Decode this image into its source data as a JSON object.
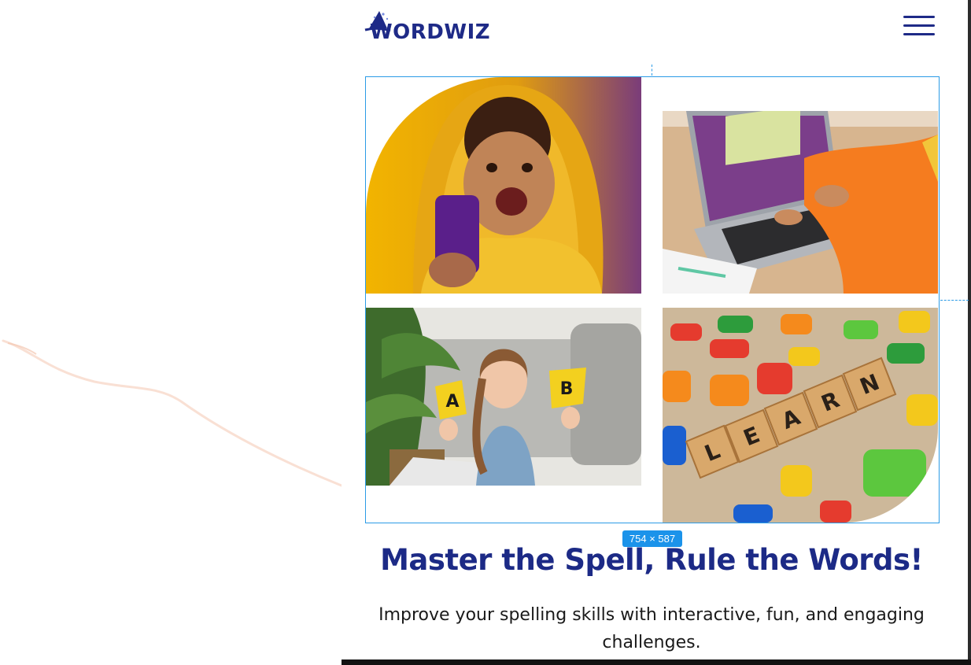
{
  "header": {
    "logo_text": "WORDWIZ",
    "menu_icon": "hamburger-menu-icon"
  },
  "inspector": {
    "selection_size": "754 × 587"
  },
  "gallery": {
    "images": [
      {
        "subject": "excited child in yellow hoodie holding phone"
      },
      {
        "subject": "child in orange sweater typing on laptop"
      },
      {
        "subject": "girl holding letter cards A and B"
      },
      {
        "subject": "wooden blocks spelling LEARN on colorful letters"
      }
    ],
    "card_letters": [
      "A",
      "B"
    ],
    "block_word": [
      "L",
      "E",
      "A",
      "R",
      "N"
    ]
  },
  "hero": {
    "headline": "Master the Spell, Rule the Words!",
    "subheadline": "Improve your spelling skills with interactive, fun, and engaging challenges."
  },
  "colors": {
    "brand": "#1e2a87",
    "selection": "#2b9be6",
    "badge": "#1b93ea"
  }
}
